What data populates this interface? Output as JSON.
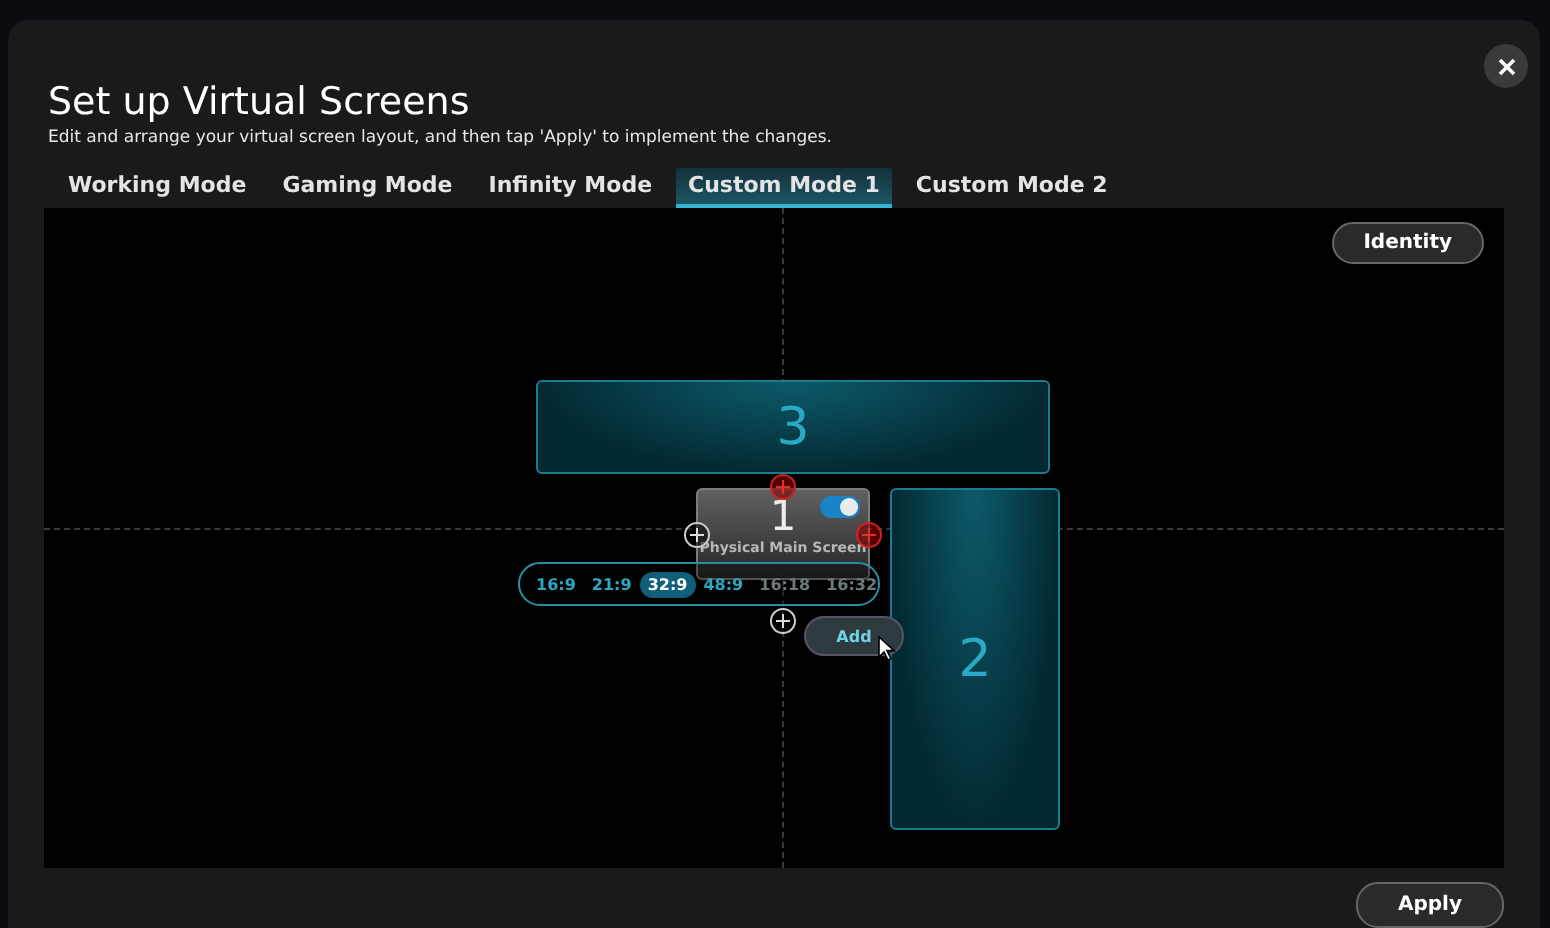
{
  "dialog": {
    "title": "Set up Virtual Screens",
    "subtitle": "Edit and arrange your virtual screen layout, and then tap 'Apply' to implement the changes."
  },
  "tabs": [
    {
      "label": "Working Mode",
      "selected": false
    },
    {
      "label": "Gaming Mode",
      "selected": false
    },
    {
      "label": "Infinity Mode",
      "selected": false
    },
    {
      "label": "Custom Mode 1",
      "selected": true
    },
    {
      "label": "Custom Mode 2",
      "selected": false
    }
  ],
  "identity_button": "Identity",
  "screens": [
    {
      "kind": "virtual",
      "number": "3"
    },
    {
      "kind": "physical",
      "number": "1",
      "label": "Physical Main Screen",
      "on": true
    },
    {
      "kind": "virtual",
      "number": "2"
    }
  ],
  "ratios": [
    {
      "label": "16:9",
      "selected": false,
      "disabled": false
    },
    {
      "label": "21:9",
      "selected": false,
      "disabled": false
    },
    {
      "label": "32:9",
      "selected": true,
      "disabled": false
    },
    {
      "label": "48:9",
      "selected": false,
      "disabled": false
    },
    {
      "label": "16:18",
      "selected": false,
      "disabled": true
    },
    {
      "label": "16:32",
      "selected": false,
      "disabled": true
    }
  ],
  "add_button": "Add",
  "apply_button": "Apply"
}
